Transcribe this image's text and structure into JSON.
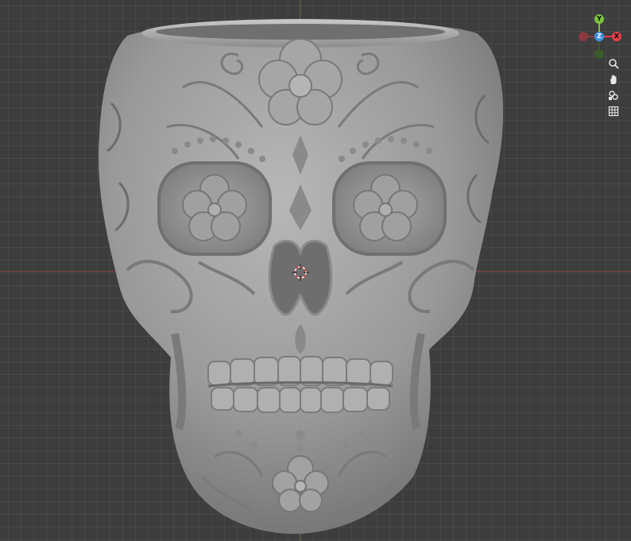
{
  "viewport": {
    "background": "#3d3d3d",
    "model_name": "sugar-skull-planter"
  },
  "gizmo": {
    "x_label": "X",
    "y_label": "Y",
    "z_label": "Z",
    "colors": {
      "x": "#e0414a",
      "y": "#7bc142",
      "z": "#3b8fe6",
      "neg_x": "#8a3a3e",
      "neg_z": "#2f5a8a"
    }
  },
  "nav_tools": [
    {
      "icon": "zoom-icon"
    },
    {
      "icon": "hand-pan-icon"
    },
    {
      "icon": "camera-view-icon"
    },
    {
      "icon": "grid-ortho-icon"
    }
  ]
}
